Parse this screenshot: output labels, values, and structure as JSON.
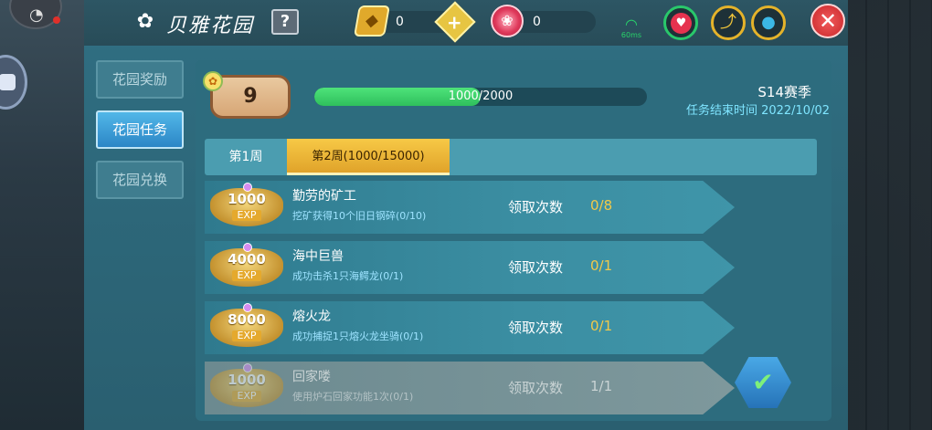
{
  "header": {
    "title": "贝雅花园",
    "help_label": "?",
    "gold_ticket_count": "0",
    "flower_count": "0",
    "network_label": "60ms",
    "close_label": "✕"
  },
  "sidebar": {
    "items": [
      {
        "label": "花园奖励",
        "active": false
      },
      {
        "label": "花园任务",
        "active": true
      },
      {
        "label": "花园兑换",
        "active": false
      }
    ]
  },
  "level": {
    "value": "9"
  },
  "progress": {
    "text": "1000/2000",
    "fraction": 0.5
  },
  "season": {
    "name": "S14赛季",
    "end_text": "任务结束时间 2022/10/02"
  },
  "weeks": [
    {
      "label": "第1周",
      "active": false
    },
    {
      "label": "第2周(1000/15000)",
      "active": true
    }
  ],
  "tasks": [
    {
      "exp": "1000",
      "unit": "EXP",
      "name": "勤劳的矿工",
      "desc": "挖矿获得10个旧日钢碎(0/10)",
      "count_label": "领取次数",
      "count": "0/8",
      "done": false
    },
    {
      "exp": "4000",
      "unit": "EXP",
      "name": "海中巨兽",
      "desc": "成功击杀1只海鳄龙(0/1)",
      "count_label": "领取次数",
      "count": "0/1",
      "done": false
    },
    {
      "exp": "8000",
      "unit": "EXP",
      "name": "熔火龙",
      "desc": "成功捕捉1只熔火龙坐骑(0/1)",
      "count_label": "领取次数",
      "count": "0/1",
      "done": false
    },
    {
      "exp": "1000",
      "unit": "EXP",
      "name": "回家喽",
      "desc": "使用炉石回家功能1次(0/1)",
      "count_label": "领取次数",
      "count": "1/1",
      "done": true
    }
  ],
  "colors": {
    "accent_gold": "#f2c949",
    "panel_teal": "#2d6c7e",
    "progress_green": "#2fbf5c",
    "close_red": "#c8262a"
  },
  "icons": {
    "title": "flower-icon",
    "gold": "gold-ticket-icon",
    "add": "plus-icon",
    "flower": "rose-icon",
    "network": "wifi-icon",
    "health": "heart-icon",
    "food": "food-icon",
    "water": "water-drop-icon",
    "done": "check-icon"
  }
}
